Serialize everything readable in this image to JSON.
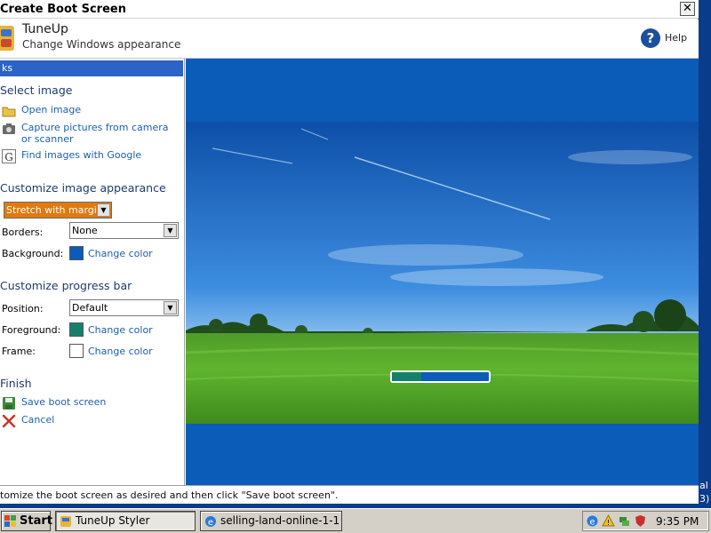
{
  "window": {
    "title": "Create Boot Screen",
    "close_glyph": "✕"
  },
  "header": {
    "app_name": "TuneUp",
    "subtitle": "Change Windows appearance",
    "help_label": "Help",
    "help_glyph": "?"
  },
  "sidebar": {
    "tasks_label": "ks",
    "select_image": {
      "title": "Select image",
      "links": [
        {
          "label": "Open image",
          "icon": "folder-icon"
        },
        {
          "label": "Capture pictures from camera or scanner",
          "icon": "camera-icon"
        },
        {
          "label": "Find images with Google",
          "icon": "google-icon"
        }
      ]
    },
    "appearance": {
      "title": "Customize image appearance",
      "mode_value": "Stretch with margins",
      "borders_label": "Borders:",
      "borders_value": "None",
      "background_label": "Background:",
      "background_color": "#0a5cb8",
      "background_link": "Change color"
    },
    "progress_bar": {
      "title": "Customize progress bar",
      "position_label": "Position:",
      "position_value": "Default",
      "foreground_label": "Foreground:",
      "foreground_color": "#15806a",
      "foreground_link": "Change color",
      "frame_label": "Frame:",
      "frame_color": "#ffffff",
      "frame_link": "Change color"
    },
    "finish": {
      "title": "Finish",
      "save_label": "Save boot screen",
      "cancel_label": "Cancel"
    }
  },
  "preview": {
    "progress_fraction": 0.3
  },
  "status": {
    "text": "tomize the boot screen as desired and then click \"Save boot screen\"."
  },
  "taskbar": {
    "start_label": "Start",
    "tasks": [
      {
        "label": "TuneUp Styler",
        "icon": "tuneup-icon",
        "active": true
      },
      {
        "label": "selling-land-online-1-1...",
        "icon": "ie-icon",
        "active": false
      }
    ],
    "clock": "9:35 PM"
  },
  "desktop": {
    "fragment_1": "al",
    "fragment_2": "3)"
  }
}
